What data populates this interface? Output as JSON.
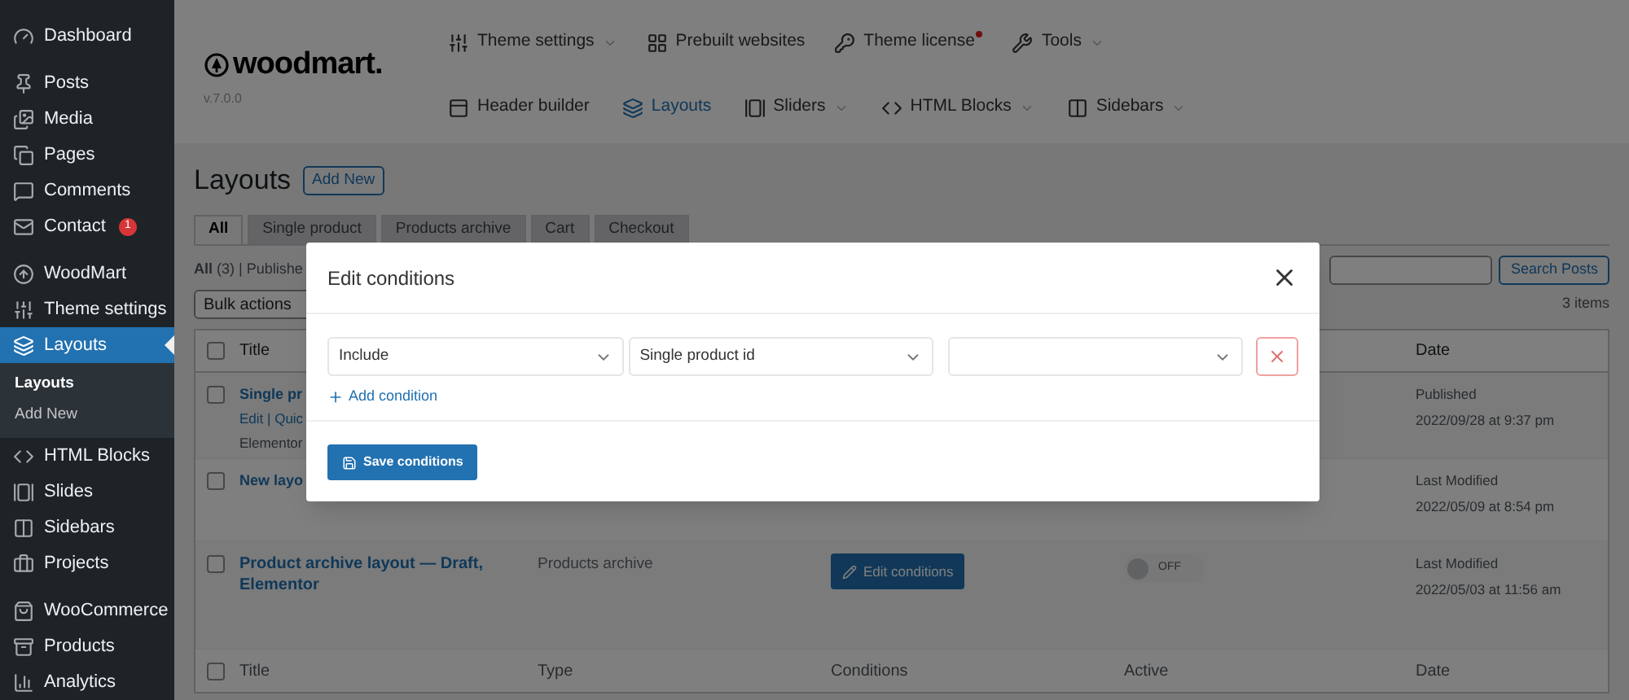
{
  "sidebar": {
    "groups": [
      [
        {
          "label": "Dashboard",
          "selected": false
        }
      ],
      [
        {
          "label": "Posts",
          "selected": false
        },
        {
          "label": "Media",
          "selected": false
        },
        {
          "label": "Pages",
          "selected": false
        },
        {
          "label": "Comments",
          "selected": false
        },
        {
          "label": "Contact",
          "selected": false,
          "badge": "1"
        }
      ],
      [
        {
          "label": "WoodMart",
          "selected": false
        },
        {
          "label": "Theme settings",
          "selected": false
        },
        {
          "label": "Layouts",
          "selected": true,
          "children": [
            {
              "label": "Layouts",
              "selected": true
            },
            {
              "label": "Add New",
              "selected": false
            }
          ]
        },
        {
          "label": "HTML Blocks",
          "selected": false
        },
        {
          "label": "Slides",
          "selected": false
        },
        {
          "label": "Sidebars",
          "selected": false
        },
        {
          "label": "Projects",
          "selected": false
        }
      ],
      [
        {
          "label": "WooCommerce",
          "selected": false
        },
        {
          "label": "Products",
          "selected": false
        },
        {
          "label": "Analytics",
          "selected": false
        }
      ]
    ]
  },
  "theme_header": {
    "logo": "woodmart.",
    "version": "v.7.0.0",
    "nav_top": [
      {
        "label": "Theme settings",
        "dropdown": true,
        "dot": false
      },
      {
        "label": "Prebuilt websites",
        "dropdown": false,
        "dot": false
      },
      {
        "label": "Theme license",
        "dropdown": false,
        "dot": true
      },
      {
        "label": "Tools",
        "dropdown": true,
        "dot": false
      }
    ],
    "nav_bottom": [
      {
        "label": "Header builder",
        "dropdown": false,
        "selected": false
      },
      {
        "label": "Layouts",
        "dropdown": false,
        "selected": true
      },
      {
        "label": "Sliders",
        "dropdown": true,
        "selected": false
      },
      {
        "label": "HTML Blocks",
        "dropdown": true,
        "selected": false
      },
      {
        "label": "Sidebars",
        "dropdown": true,
        "selected": false
      }
    ]
  },
  "page": {
    "title": "Layouts",
    "add_new": "Add New",
    "tabs": [
      {
        "label": "All",
        "selected": true
      },
      {
        "label": "Single product",
        "selected": false
      },
      {
        "label": "Products archive",
        "selected": false
      },
      {
        "label": "Cart",
        "selected": false
      },
      {
        "label": "Checkout",
        "selected": false
      }
    ],
    "views": "**All** (3) | Publishe",
    "bulk_actions": "Bulk actions",
    "search_button": "Search Posts",
    "count": "3 items",
    "table": {
      "header": {
        "checked": false,
        "title": "Title",
        "date": "Date"
      },
      "rows": [
        {
          "checked": false,
          "title": "Single pr",
          "actions": "Edit | Quic",
          "state": "Elementor",
          "date_status": "Published",
          "date": "2022/09/28 at 9:37 pm"
        },
        {
          "checked": false,
          "title": "New layo",
          "date_status": "Last Modified",
          "date": "2022/05/09 at 8:54 pm"
        },
        {
          "checked": false,
          "title": "Product archive layout — Draft, Elementor",
          "type": "Products archive",
          "conditions_button": "Edit conditions",
          "active": {
            "on": false,
            "label": "OFF"
          },
          "date_status": "Last Modified",
          "date": "2022/05/03 at 11:56 am"
        }
      ],
      "footer": {
        "checked": false,
        "columns": [
          "Title",
          "Type",
          "Conditions",
          "Active",
          "Date"
        ]
      }
    }
  },
  "modal": {
    "title": "Edit conditions",
    "condition": {
      "type": "Include",
      "target": "Single product id"
    },
    "add_condition": "Add condition",
    "save": "Save conditions"
  }
}
